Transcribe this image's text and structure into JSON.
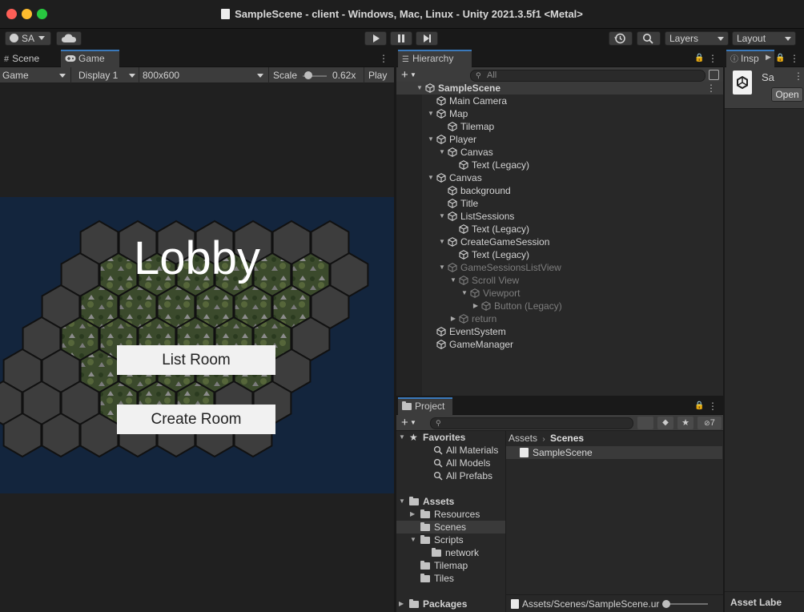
{
  "window": {
    "title": "SampleScene - client - Windows, Mac, Linux - Unity 2021.3.5f1 <Metal>"
  },
  "toolbar": {
    "account_label": "SA",
    "layers_label": "Layers",
    "layout_label": "Layout",
    "play_icon": "play-icon",
    "pause_icon": "pause-icon",
    "step_icon": "step-icon"
  },
  "scene_game": {
    "tabs": [
      {
        "label": "Scene"
      },
      {
        "label": "Game"
      }
    ],
    "controls": {
      "mode": "Game",
      "display": "Display 1",
      "resolution": "800x600",
      "scale_label": "Scale",
      "scale_value": "0.62x",
      "play_focus": "Play F"
    },
    "scale_slider_fraction": 0.1,
    "game": {
      "title": "Lobby",
      "buttons": [
        {
          "label": "List Room"
        },
        {
          "label": "Create Room"
        }
      ]
    }
  },
  "hierarchy": {
    "tab_label": "Hierarchy",
    "search_placeholder": "All",
    "items": [
      {
        "label": "SampleScene",
        "depth": 0,
        "expanded": true,
        "type": "scene",
        "disabled": false
      },
      {
        "label": "Main Camera",
        "depth": 1,
        "expanded": null,
        "type": "object",
        "disabled": false
      },
      {
        "label": "Map",
        "depth": 1,
        "expanded": true,
        "type": "object",
        "disabled": false
      },
      {
        "label": "Tilemap",
        "depth": 2,
        "expanded": null,
        "type": "object",
        "disabled": false
      },
      {
        "label": "Player",
        "depth": 1,
        "expanded": true,
        "type": "object",
        "disabled": false
      },
      {
        "label": "Canvas",
        "depth": 2,
        "expanded": true,
        "type": "object",
        "disabled": false
      },
      {
        "label": "Text (Legacy)",
        "depth": 3,
        "expanded": null,
        "type": "object",
        "disabled": false
      },
      {
        "label": "Canvas",
        "depth": 1,
        "expanded": true,
        "type": "object",
        "disabled": false
      },
      {
        "label": "background",
        "depth": 2,
        "expanded": null,
        "type": "object",
        "disabled": false
      },
      {
        "label": "Title",
        "depth": 2,
        "expanded": null,
        "type": "object",
        "disabled": false
      },
      {
        "label": "ListSessions",
        "depth": 2,
        "expanded": true,
        "type": "object",
        "disabled": false
      },
      {
        "label": "Text (Legacy)",
        "depth": 3,
        "expanded": null,
        "type": "object",
        "disabled": false
      },
      {
        "label": "CreateGameSession",
        "depth": 2,
        "expanded": true,
        "type": "object",
        "disabled": false
      },
      {
        "label": "Text (Legacy)",
        "depth": 3,
        "expanded": null,
        "type": "object",
        "disabled": false
      },
      {
        "label": "GameSessionsListView",
        "depth": 2,
        "expanded": true,
        "type": "object",
        "disabled": true
      },
      {
        "label": "Scroll View",
        "depth": 3,
        "expanded": true,
        "type": "object",
        "disabled": true
      },
      {
        "label": "Viewport",
        "depth": 4,
        "expanded": true,
        "type": "object",
        "disabled": true
      },
      {
        "label": "Button (Legacy)",
        "depth": 5,
        "expanded": false,
        "type": "object",
        "disabled": true
      },
      {
        "label": "return",
        "depth": 3,
        "expanded": false,
        "type": "object",
        "disabled": true
      },
      {
        "label": "EventSystem",
        "depth": 1,
        "expanded": null,
        "type": "object",
        "disabled": false
      },
      {
        "label": "GameManager",
        "depth": 1,
        "expanded": null,
        "type": "object",
        "disabled": false
      }
    ]
  },
  "project": {
    "tab_label": "Project",
    "hidden_count": "7",
    "breadcrumb": [
      "Assets",
      "Scenes"
    ],
    "tree": [
      {
        "label": "Favorites",
        "depth": 0,
        "expanded": true,
        "icon": "star-icon",
        "bold": true,
        "selected": false
      },
      {
        "label": "All Materials",
        "depth": 1,
        "expanded": null,
        "icon": "search-icon",
        "bold": false,
        "selected": false
      },
      {
        "label": "All Models",
        "depth": 1,
        "expanded": null,
        "icon": "search-icon",
        "bold": false,
        "selected": false
      },
      {
        "label": "All Prefabs",
        "depth": 1,
        "expanded": null,
        "icon": "search-icon",
        "bold": false,
        "selected": false
      },
      {
        "label": "Assets",
        "depth": 0,
        "expanded": true,
        "icon": "folder-open-icon",
        "bold": true,
        "selected": false
      },
      {
        "label": "Resources",
        "depth": 1,
        "expanded": false,
        "icon": "folder-icon",
        "bold": false,
        "selected": false
      },
      {
        "label": "Scenes",
        "depth": 1,
        "expanded": null,
        "icon": "folder-icon",
        "bold": false,
        "selected": true
      },
      {
        "label": "Scripts",
        "depth": 1,
        "expanded": true,
        "icon": "folder-open-icon",
        "bold": false,
        "selected": false
      },
      {
        "label": "network",
        "depth": 2,
        "expanded": null,
        "icon": "folder-icon",
        "bold": false,
        "selected": false
      },
      {
        "label": "Tilemap",
        "depth": 1,
        "expanded": null,
        "icon": "folder-icon",
        "bold": false,
        "selected": false
      },
      {
        "label": "Tiles",
        "depth": 1,
        "expanded": null,
        "icon": "folder-icon",
        "bold": false,
        "selected": false
      },
      {
        "label": "Packages",
        "depth": 0,
        "expanded": false,
        "icon": "folder-icon",
        "bold": true,
        "selected": false
      }
    ],
    "assets": [
      {
        "label": "SampleScene",
        "icon": "unity-scene-icon",
        "selected": true
      }
    ],
    "footer_path": "Assets/Scenes/SampleScene.ur"
  },
  "inspector": {
    "tab_label": "Insp",
    "asset_name": "Sa",
    "open_button": "Open",
    "footer_label": "Asset Labe"
  },
  "colors": {
    "accent_tab": "#3a79bb",
    "canvas_bg": "#13253d",
    "hex_gray": "#3d3d3d"
  }
}
